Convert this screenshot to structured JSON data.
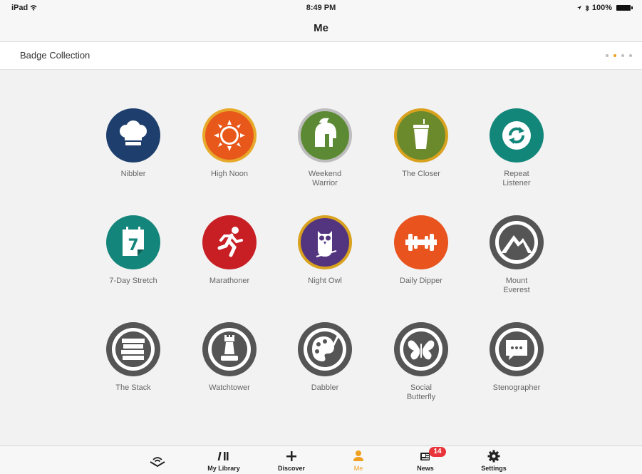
{
  "status_bar": {
    "carrier": "iPad",
    "time": "8:49 PM",
    "battery": "100%"
  },
  "nav": {
    "title": "Me"
  },
  "section": {
    "title": "Badge Collection",
    "page_count": 4,
    "active_page": 1
  },
  "badges": [
    {
      "label": "Nibbler",
      "icon": "chef-hat-icon",
      "color": "#1e3f6d",
      "ring": "#1e3f6d"
    },
    {
      "label": "High Noon",
      "icon": "sun-icon",
      "color": "#e8581a",
      "ring": "#e7a92a"
    },
    {
      "label": "Weekend\nWarrior",
      "icon": "spartan-helmet-icon",
      "color": "#5c8a34",
      "ring": "#bdbdbd"
    },
    {
      "label": "The Closer",
      "icon": "coffee-cup-icon",
      "color": "#6b8a2c",
      "ring": "#d9a21e"
    },
    {
      "label": "Repeat\nListener",
      "icon": "repeat-icon",
      "color": "#13867a",
      "ring": "#13867a"
    },
    {
      "label": "7-Day Stretch",
      "icon": "calendar-seven-icon",
      "color": "#14857a",
      "ring": "#14857a"
    },
    {
      "label": "Marathoner",
      "icon": "runner-icon",
      "color": "#c71f24",
      "ring": "#c71f24"
    },
    {
      "label": "Night Owl",
      "icon": "owl-icon",
      "color": "#53357f",
      "ring": "#d9a21e"
    },
    {
      "label": "Daily Dipper",
      "icon": "dumbbell-icon",
      "color": "#e8531e",
      "ring": "#e8531e"
    },
    {
      "label": "Mount\nEverest",
      "icon": "mountain-icon",
      "color": "#555555",
      "ring": "#555555"
    },
    {
      "label": "The Stack",
      "icon": "book-stack-icon",
      "color": "#555555",
      "ring": "#555555"
    },
    {
      "label": "Watchtower",
      "icon": "rook-tower-icon",
      "color": "#555555",
      "ring": "#555555"
    },
    {
      "label": "Dabbler",
      "icon": "palette-icon",
      "color": "#555555",
      "ring": "#555555"
    },
    {
      "label": "Social\nButterfly",
      "icon": "butterfly-icon",
      "color": "#555555",
      "ring": "#555555"
    },
    {
      "label": "Stenographer",
      "icon": "speech-bubble-icon",
      "color": "#555555",
      "ring": "#555555"
    }
  ],
  "tabs": [
    {
      "label": "",
      "icon": "audible-logo-icon"
    },
    {
      "label": "My Library",
      "icon": "library-icon"
    },
    {
      "label": "Discover",
      "icon": "plus-icon"
    },
    {
      "label": "Me",
      "icon": "person-icon",
      "active": true
    },
    {
      "label": "News",
      "icon": "news-icon",
      "badge": "14"
    },
    {
      "label": "Settings",
      "icon": "gear-icon"
    }
  ],
  "colors": {
    "accent": "#f0a020",
    "news_badge": "#e8343a"
  }
}
